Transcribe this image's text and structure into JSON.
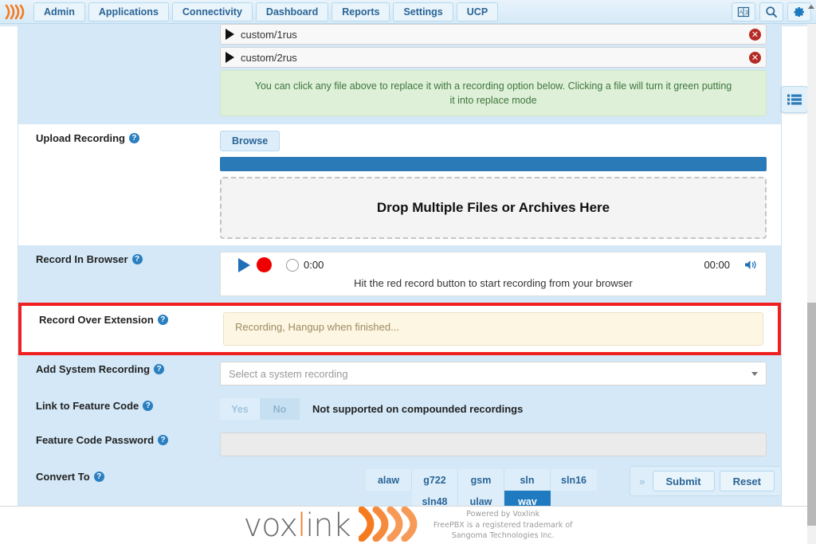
{
  "nav": {
    "logo_icon": "voxlink-waves-icon",
    "items": [
      {
        "label": "Admin",
        "name": "nav-admin"
      },
      {
        "label": "Applications",
        "name": "nav-applications"
      },
      {
        "label": "Connectivity",
        "name": "nav-connectivity"
      },
      {
        "label": "Dashboard",
        "name": "nav-dashboard"
      },
      {
        "label": "Reports",
        "name": "nav-reports"
      },
      {
        "label": "Settings",
        "name": "nav-settings"
      },
      {
        "label": "UCP",
        "name": "nav-ucp"
      }
    ],
    "right_icons": [
      {
        "name": "language-icon",
        "glyph": "translate"
      },
      {
        "name": "search-icon",
        "glyph": "magnifier"
      },
      {
        "name": "gear-icon",
        "glyph": "cog"
      }
    ]
  },
  "files": [
    {
      "name": "custom/1rus",
      "play_icon": "play-icon",
      "delete_icon": "delete-circle-icon",
      "delete_glyph": "✕"
    },
    {
      "name": "custom/2rus",
      "play_icon": "play-icon",
      "delete_icon": "delete-circle-icon",
      "delete_glyph": "✕"
    }
  ],
  "hint": {
    "text": "You can click any file above to replace it with a recording option below. Clicking a file will turn it green putting it into replace mode"
  },
  "upload": {
    "label": "Upload Recording",
    "browse_label": "Browse",
    "dropzone_text": "Drop Multiple Files or Archives Here",
    "progress_percent": 100
  },
  "record_browser": {
    "label": "Record In Browser",
    "play_icon": "play-icon",
    "record_icon": "record-circle-icon",
    "time_current": "0:00",
    "time_total": "00:00",
    "volume_icon": "speaker-icon",
    "hint": "Hit the red record button to start recording from your browser"
  },
  "record_extension": {
    "label": "Record Over Extension",
    "status_text": "Recording, Hangup when finished...",
    "highlight_color": "#f02020"
  },
  "add_system_recording": {
    "label": "Add System Recording",
    "placeholder": "Select a system recording",
    "caret_icon": "chevron-down-icon"
  },
  "link_feature_code": {
    "label": "Link to Feature Code",
    "yes_label": "Yes",
    "no_label": "No",
    "selected": "No",
    "note": "Not supported on compounded recordings"
  },
  "feature_code_password": {
    "label": "Feature Code Password",
    "value": "",
    "placeholder": ""
  },
  "convert_to": {
    "label": "Convert To",
    "row1": [
      "alaw",
      "g722",
      "gsm",
      "sln",
      "sln16"
    ],
    "row2": [
      "sln48",
      "ulaw",
      "wav"
    ],
    "selected": "wav"
  },
  "actions": {
    "expand_glyph": "»",
    "submit_label": "Submit",
    "reset_label": "Reset"
  },
  "side_tab": {
    "name": "list-panel-icon"
  },
  "footer": {
    "brand_pre": "vox",
    "brand_i": "l",
    "brand_post": "ink",
    "logo_icon": "voxlink-waves-icon",
    "line1": "Powered by Voxlink",
    "line2": "FreePBX is a registered trademark of",
    "line3": "Sangoma Technologies Inc."
  },
  "help_glyph": "?"
}
